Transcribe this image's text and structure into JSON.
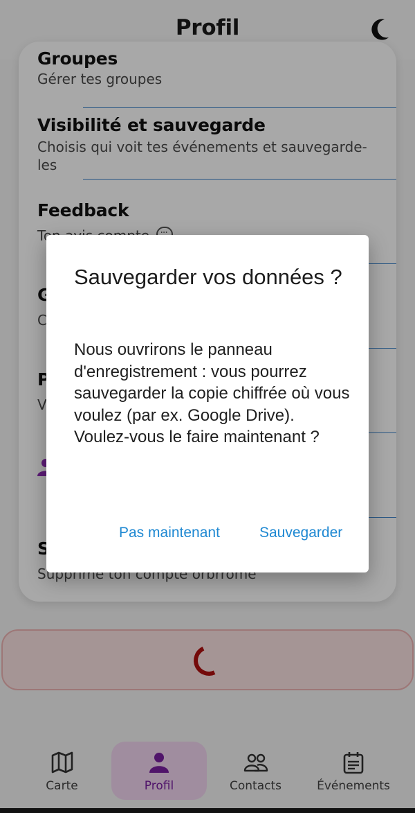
{
  "header": {
    "title": "Profil",
    "theme_icon": "moon-icon"
  },
  "settings": {
    "items": [
      {
        "title": "Groupes",
        "subtitle": "Gérer tes groupes"
      },
      {
        "title": "Visibilité et sauvegarde",
        "subtitle": "Choisis qui voit tes événements et sauvegarde-les"
      },
      {
        "title": "Feedback",
        "subtitle": "Ton avis compte"
      },
      {
        "title": "G",
        "subtitle": "C"
      },
      {
        "title": "P",
        "subtitle": "V"
      },
      {
        "title": "",
        "subtitle": ""
      },
      {
        "title": "S",
        "subtitle": "Supprime ton compte orbrrome"
      }
    ]
  },
  "dialog": {
    "title": "Sauvegarder vos données ?",
    "body": "Nous ouvrirons le panneau d'enregistrement : vous pourrez sauvegarder la copie chiffrée où vous voulez (par ex. Google Drive). Voulez-vous le faire maintenant ?",
    "cancel_label": "Pas maintenant",
    "confirm_label": "Sauvegarder"
  },
  "bottom_nav": {
    "items": [
      {
        "label": "Carte",
        "icon": "map-icon",
        "active": false
      },
      {
        "label": "Profil",
        "icon": "person-icon",
        "active": true
      },
      {
        "label": "Contacts",
        "icon": "contacts-icon",
        "active": false
      },
      {
        "label": "Événements",
        "icon": "calendar-icon",
        "active": false
      }
    ]
  },
  "colors": {
    "accent": "#1e88d2",
    "divider": "#3b82c8",
    "active_nav": "#7a1fa2",
    "active_nav_bg": "#f3d6f1",
    "danger": "#b01010"
  }
}
